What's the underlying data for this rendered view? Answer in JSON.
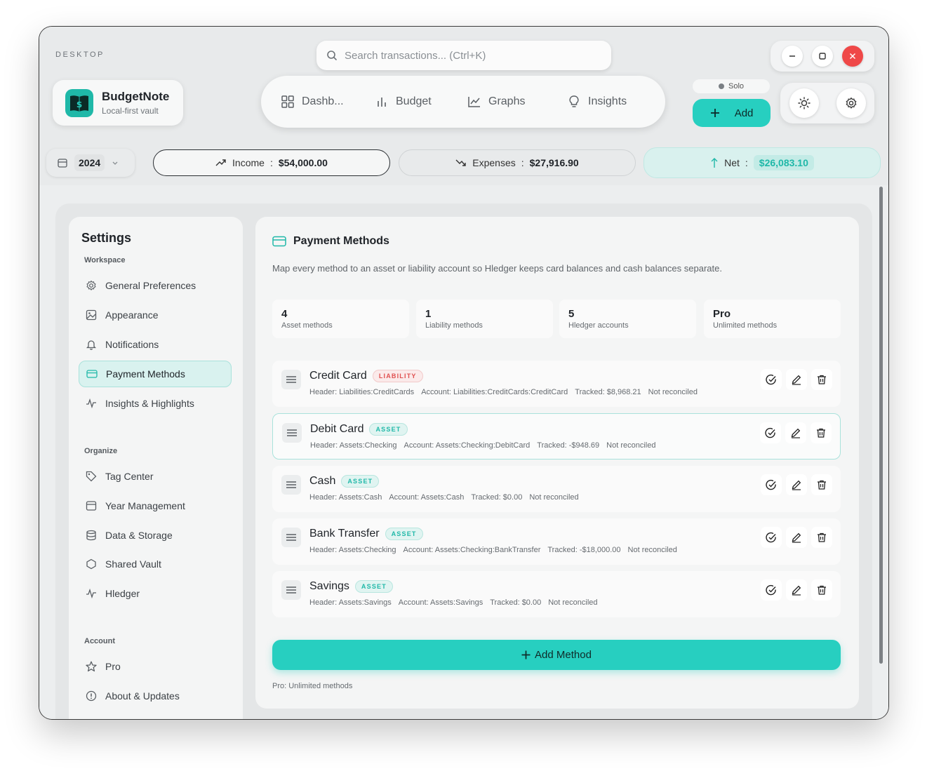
{
  "window": {
    "label": "DESKTOP"
  },
  "search": {
    "placeholder": "Search transactions... (Ctrl+K)"
  },
  "brand": {
    "name": "BudgetNote",
    "subtitle": "Local-first vault"
  },
  "nav": {
    "items": [
      {
        "label": "Dashb..."
      },
      {
        "label": "Budget"
      },
      {
        "label": "Graphs"
      },
      {
        "label": "Insights"
      }
    ]
  },
  "mode": {
    "label": "Solo"
  },
  "toolbar": {
    "add_label": "Add"
  },
  "year": {
    "value": "2024"
  },
  "summary": {
    "income_label": "Income",
    "income_value": "$54,000.00",
    "expenses_label": "Expenses",
    "expenses_value": "$27,916.90",
    "net_label": "Net",
    "net_value": "$26,083.10",
    "separator": ":"
  },
  "sidebar": {
    "title": "Settings",
    "sections": [
      {
        "title": "Workspace",
        "items": [
          {
            "label": "General Preferences",
            "icon": "gear-icon"
          },
          {
            "label": "Appearance",
            "icon": "image-icon"
          },
          {
            "label": "Notifications",
            "icon": "bell-icon"
          },
          {
            "label": "Payment Methods",
            "icon": "card-icon",
            "active": true
          },
          {
            "label": "Insights & Highlights",
            "icon": "pulse-icon"
          }
        ]
      },
      {
        "title": "Organize",
        "items": [
          {
            "label": "Tag Center",
            "icon": "tag-icon"
          },
          {
            "label": "Year Management",
            "icon": "calendar-icon"
          },
          {
            "label": "Data & Storage",
            "icon": "database-icon"
          },
          {
            "label": "Shared Vault",
            "icon": "hexagon-icon"
          },
          {
            "label": "Hledger",
            "icon": "pulse-icon"
          }
        ]
      },
      {
        "title": "Account",
        "items": [
          {
            "label": "Pro",
            "icon": "star-icon"
          },
          {
            "label": "About & Updates",
            "icon": "info-icon"
          }
        ]
      }
    ]
  },
  "payment": {
    "title": "Payment Methods",
    "description": "Map every method to an asset or liability account so Hledger keeps card balances and cash balances separate.",
    "stats": [
      {
        "value": "4",
        "label": "Asset methods"
      },
      {
        "value": "1",
        "label": "Liability methods"
      },
      {
        "value": "5",
        "label": "Hledger accounts"
      },
      {
        "value": "Pro",
        "label": "Unlimited methods"
      }
    ],
    "methods": [
      {
        "name": "Credit Card",
        "badge": "LIABILITY",
        "header": "Header: Liabilities:CreditCards",
        "account": "Account: Liabilities:CreditCards:CreditCard",
        "tracked": "Tracked: $8,968.21",
        "status": "Not reconciled"
      },
      {
        "name": "Debit Card",
        "badge": "ASSET",
        "header": "Header: Assets:Checking",
        "account": "Account: Assets:Checking:DebitCard",
        "tracked": "Tracked: -$948.69",
        "status": "Not reconciled"
      },
      {
        "name": "Cash",
        "badge": "ASSET",
        "header": "Header: Assets:Cash",
        "account": "Account: Assets:Cash",
        "tracked": "Tracked: $0.00",
        "status": "Not reconciled"
      },
      {
        "name": "Bank Transfer",
        "badge": "ASSET",
        "header": "Header: Assets:Checking",
        "account": "Account: Assets:Checking:BankTransfer",
        "tracked": "Tracked: -$18,000.00",
        "status": "Not reconciled"
      },
      {
        "name": "Savings",
        "badge": "ASSET",
        "header": "Header: Assets:Savings",
        "account": "Account: Assets:Savings",
        "tracked": "Tracked: $0.00",
        "status": "Not reconciled"
      }
    ],
    "add_label": "Add Method",
    "footer": "Pro: Unlimited methods"
  },
  "colors": {
    "accent": "#27cfc0",
    "liability": "#e05050",
    "asset": "#1fb8a8",
    "close": "#ef4848"
  }
}
